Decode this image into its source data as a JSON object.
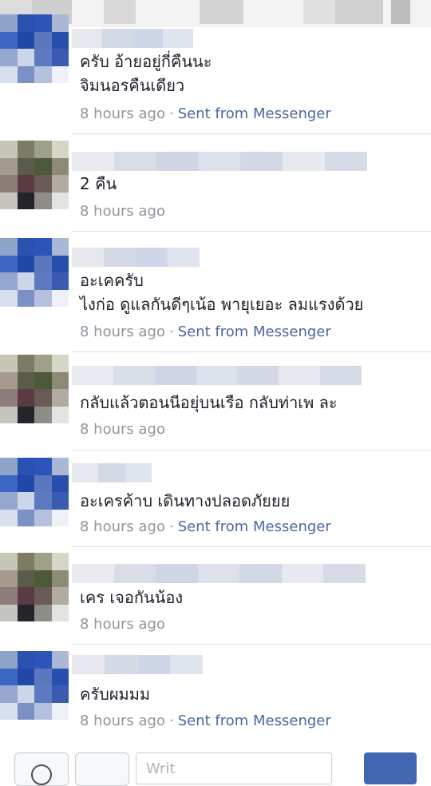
{
  "messages": [
    {
      "lines": [
        "ครับ อ้ายอยู่กี่คืนนะ",
        "จิมนอรคืนเดียว"
      ],
      "time": "8 hours ago",
      "source": "Sent from Messenger"
    },
    {
      "lines": [
        "2 คืน"
      ],
      "time": "8 hours ago",
      "source": ""
    },
    {
      "lines": [
        "อะเคครับ",
        "ไงก่อ ดูแลกันดีๆเน้อ พายุเยอะ ลมแรงด้วย"
      ],
      "time": "8 hours ago",
      "source": "Sent from Messenger"
    },
    {
      "lines": [
        "กลับแล้วตอนนีอยุ่บนเรือ กลับท่าเพ ละ"
      ],
      "time": "8 hours ago",
      "source": ""
    },
    {
      "lines": [
        "อะเครค้าบ เดินทางปลอดภัยยย"
      ],
      "time": "8 hours ago",
      "source": "Sent from Messenger"
    },
    {
      "lines": [
        "เคร เจอกันน้อง"
      ],
      "time": "8 hours ago",
      "source": ""
    },
    {
      "lines": [
        "ครับผมมม"
      ],
      "time": "8 hours ago",
      "source": "Sent from Messenger"
    }
  ],
  "composer": {
    "placeholder": "Writ"
  },
  "meta_separator": "·"
}
